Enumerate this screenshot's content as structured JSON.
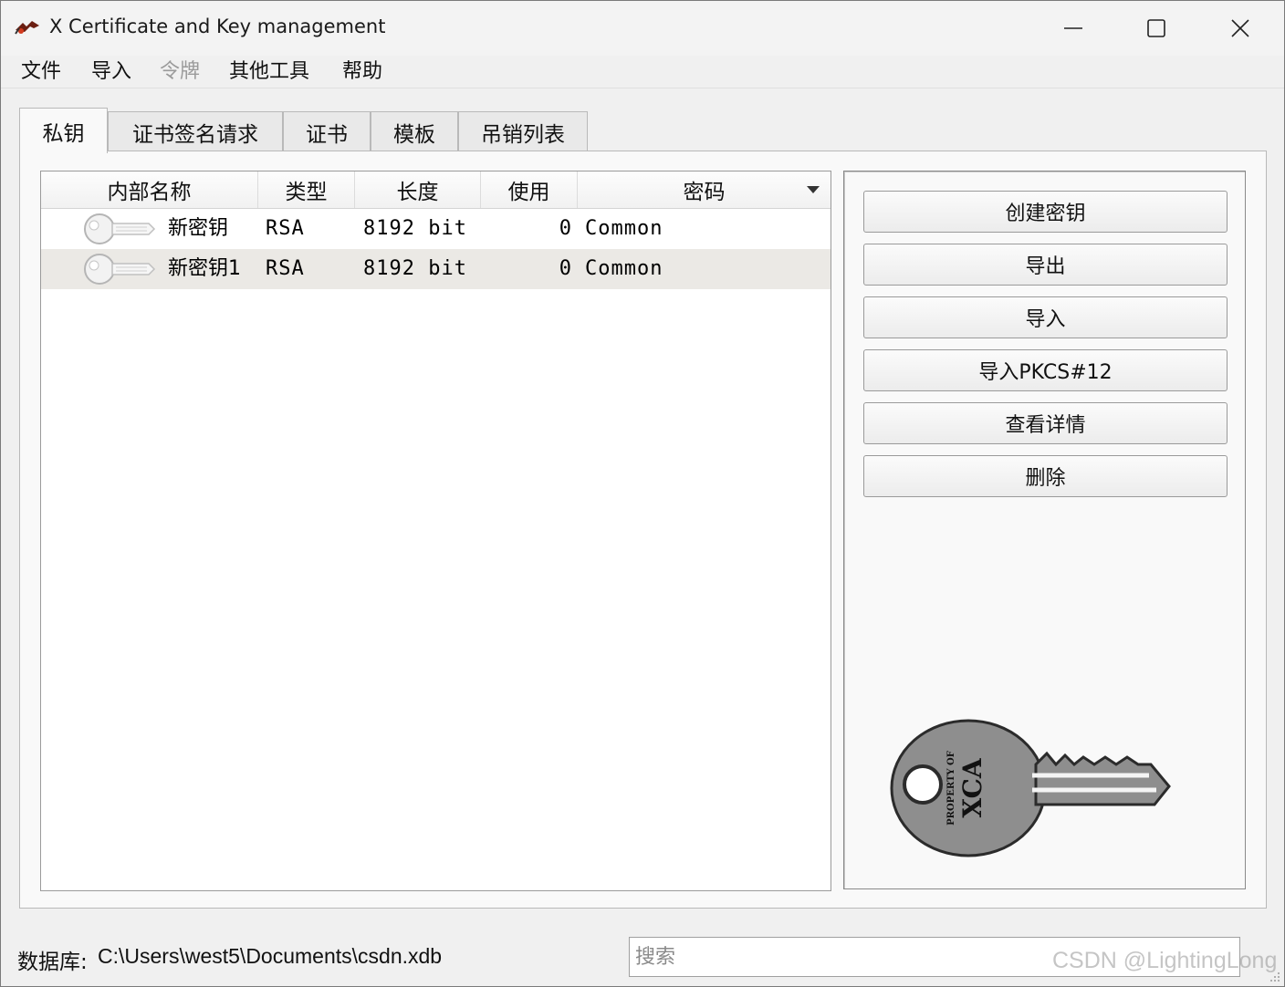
{
  "window": {
    "title": "X Certificate and Key management",
    "controls": {
      "minimize": "minimize-icon",
      "maximize": "maximize-icon",
      "close": "close-icon"
    }
  },
  "menu": [
    {
      "label": "文件",
      "enabled": true
    },
    {
      "label": "导入",
      "enabled": true
    },
    {
      "label": "令牌",
      "enabled": false
    },
    {
      "label": "其他工具",
      "enabled": true
    },
    {
      "label": "帮助",
      "enabled": true
    }
  ],
  "tabs": [
    {
      "label": "私钥",
      "active": true
    },
    {
      "label": "证书签名请求",
      "active": false
    },
    {
      "label": "证书",
      "active": false
    },
    {
      "label": "模板",
      "active": false
    },
    {
      "label": "吊销列表",
      "active": false
    }
  ],
  "table": {
    "columns": [
      "内部名称",
      "类型",
      "长度",
      "使用",
      "密码"
    ],
    "rows": [
      {
        "name": "新密钥",
        "type": "RSA",
        "length": "8192 bit",
        "use": "0",
        "password": "Common"
      },
      {
        "name": "新密钥1",
        "type": "RSA",
        "length": "8192 bit",
        "use": "0",
        "password": "Common"
      }
    ]
  },
  "actions": {
    "create": "创建密钥",
    "export": "导出",
    "import": "导入",
    "import_pkcs12": "导入PKCS#12",
    "details": "查看详情",
    "delete": "删除"
  },
  "statusbar": {
    "db_label": "数据库:",
    "db_path": "C:\\Users\\west5\\Documents\\csdn.xdb",
    "search_placeholder": "搜索"
  },
  "image_text": {
    "key_stamp": "PROPERTY OF",
    "key_brand": "XCA"
  },
  "watermark": "CSDN @LightingLong",
  "colors": {
    "window_bg": "#f0f0f0",
    "panel_bg": "#f9f9f9",
    "alt_row": "#ebe9e5"
  }
}
